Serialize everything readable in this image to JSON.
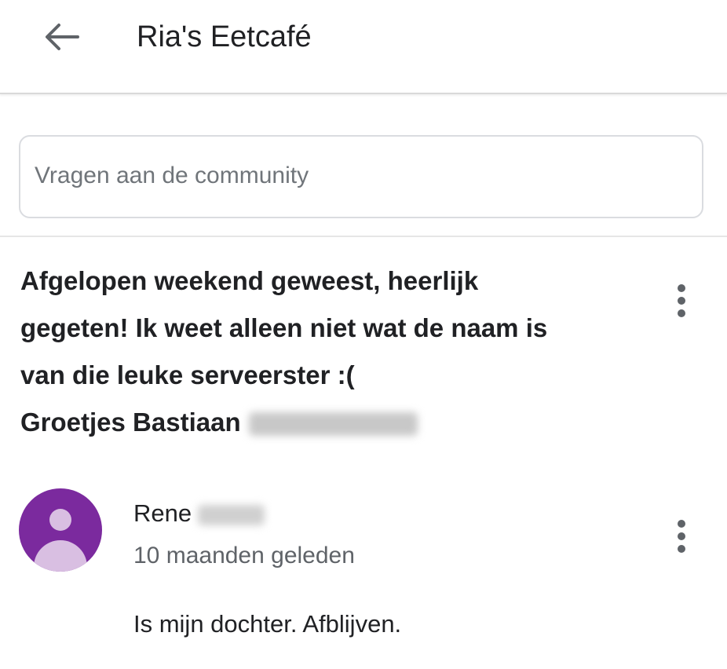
{
  "app_bar": {
    "title": "Ria's Eetcafé",
    "back_icon": "arrow-back-icon"
  },
  "ask_box": {
    "placeholder": "Vragen aan de community"
  },
  "question": {
    "lines": [
      "Afgelopen weekend geweest, heerlijk",
      "gegeten! Ik weet alleen niet wat de naam is",
      "van die leuke serveerster :(",
      "Groetjes Bastiaan"
    ],
    "more_icon": "more-vert-icon"
  },
  "answer": {
    "author": "Rene",
    "time": "10 maanden geleden",
    "text": "Is mijn dochter. Afblijven.",
    "avatar_icon": "person-avatar-icon",
    "avatar_color": "#7b2a9e",
    "more_icon": "more-vert-icon"
  }
}
